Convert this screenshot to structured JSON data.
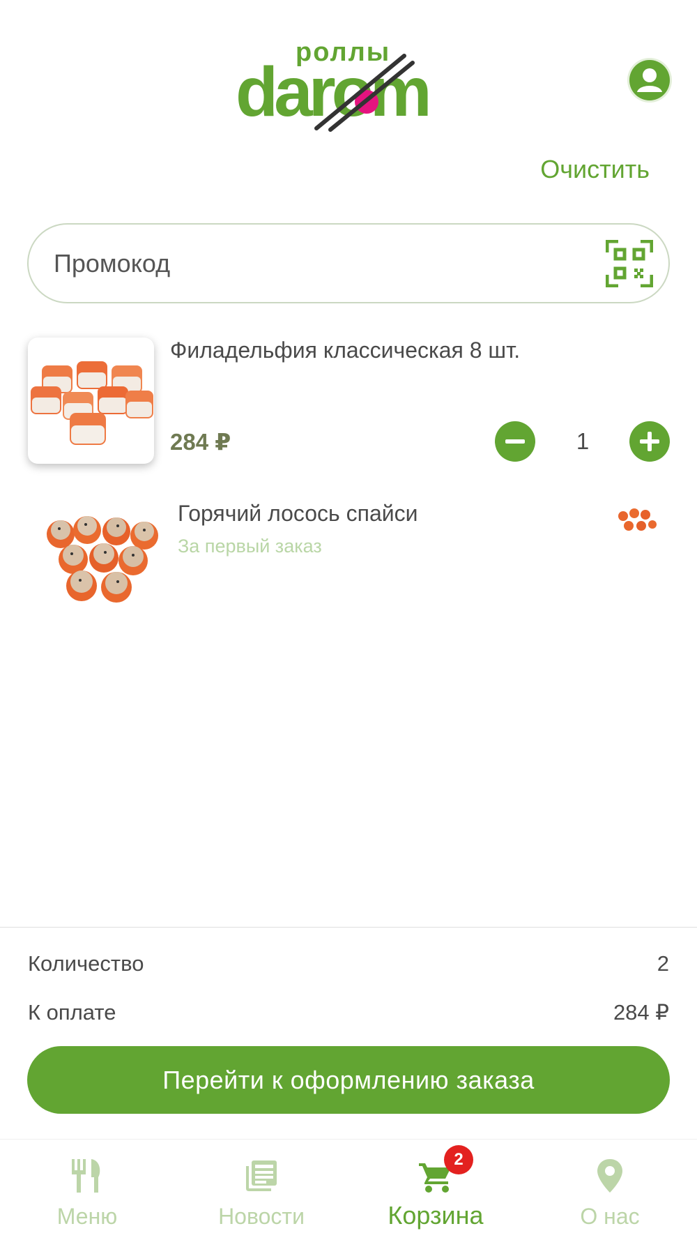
{
  "header": {
    "logo_top": "роллы",
    "logo_main": "darom",
    "clear_label": "Очистить"
  },
  "promo": {
    "placeholder": "Промокод"
  },
  "cart": {
    "items": [
      {
        "name": "Филадельфия классическая 8 шт.",
        "price": "284 ₽",
        "quantity": "1"
      }
    ],
    "gift": {
      "name": "Горячий лосось спайси",
      "note": "За первый заказ"
    }
  },
  "summary": {
    "quantity_label": "Количество",
    "quantity_value": "2",
    "total_label": "К оплате",
    "total_value": "284 ₽",
    "checkout_label": "Перейти к оформлению заказа"
  },
  "nav": {
    "items": [
      {
        "label": "Меню",
        "icon": "fork-knife-icon"
      },
      {
        "label": "Новости",
        "icon": "news-icon"
      },
      {
        "label": "Корзина",
        "icon": "cart-icon",
        "active": true
      },
      {
        "label": "О нас",
        "icon": "location-pin-icon"
      }
    ],
    "cart_badge": "2"
  },
  "colors": {
    "accent": "#62a532",
    "inactive": "#bcd5a8",
    "badge": "#e3211f",
    "price": "#6f7a52"
  }
}
